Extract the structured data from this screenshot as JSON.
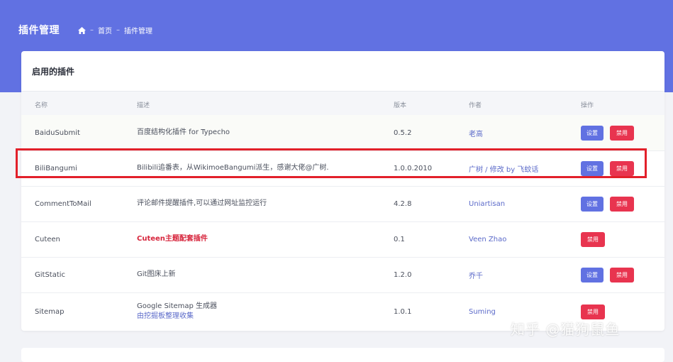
{
  "header": {
    "title": "插件管理",
    "breadcrumb": {
      "sep": "–",
      "home": "首页",
      "current": "插件管理"
    }
  },
  "card": {
    "title": "启用的插件",
    "columns": {
      "name": "名称",
      "desc": "描述",
      "version": "版本",
      "author": "作者",
      "ops": "操作"
    },
    "set_label": "设置",
    "disable_label": "禁用",
    "rows": [
      {
        "name": "BaiduSubmit",
        "desc": "百度结构化插件 for Typecho",
        "version": "0.5.2",
        "author": "老高",
        "has_settings": true
      },
      {
        "name": "BiliBangumi",
        "desc": "Bilibili追番表，从WikimoeBangumi派生，感谢大佬@广树.",
        "version": "1.0.0.2010",
        "author": "广树 / 修改 by 飞蚊话",
        "has_settings": true
      },
      {
        "name": "CommentToMail",
        "desc": "评论邮件提醒插件,可以通过网址监控运行",
        "version": "4.2.8",
        "author": "Uniartisan",
        "has_settings": true
      },
      {
        "name": "Cuteen",
        "desc": "Cuteen主题配套插件",
        "version": "0.1",
        "author": "Veen Zhao",
        "has_settings": false
      },
      {
        "name": "GitStatic",
        "desc": "Git图床上新",
        "version": "1.2.0",
        "author": "乔千",
        "has_settings": true
      },
      {
        "name": "Sitemap",
        "desc": "Google Sitemap 生成器",
        "desc2": "由挖掘板整理收集",
        "version": "1.0.1",
        "author": "Suming",
        "has_settings": false
      }
    ]
  },
  "watermark": "知乎 @猫狗鼠鱼",
  "colors": {
    "banner": "#6171e2",
    "set_button": "#6171e2",
    "disable_button": "#e8344f",
    "highlight": "#e2202a"
  }
}
